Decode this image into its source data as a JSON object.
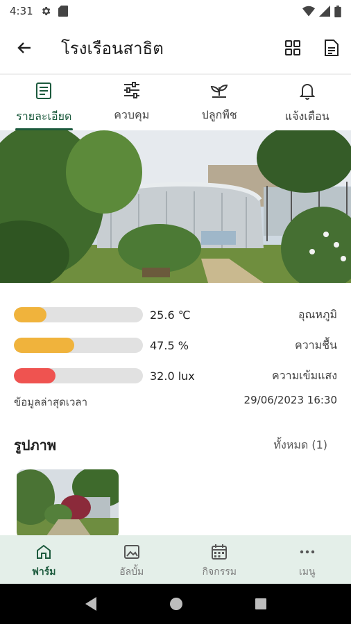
{
  "status_bar": {
    "time": "4:31",
    "icons": [
      "gear-icon",
      "sd-card-icon",
      "wifi-icon",
      "signal-icon",
      "battery-icon"
    ]
  },
  "app_bar": {
    "title": "โรงเรือนสาธิต",
    "actions": [
      "grid-view-icon",
      "document-icon"
    ]
  },
  "tabs": [
    {
      "label": "รายละเอียด",
      "icon": "details-icon",
      "active": true
    },
    {
      "label": "ควบคุม",
      "icon": "sliders-icon",
      "active": false
    },
    {
      "label": "ปลูกพืช",
      "icon": "plant-icon",
      "active": false
    },
    {
      "label": "แจ้งเตือน",
      "icon": "bell-icon",
      "active": false
    }
  ],
  "metrics": [
    {
      "value": "25.6 ℃",
      "label": "อุณหภูมิ",
      "level": 0.25,
      "color": "#f0b33c"
    },
    {
      "value": "47.5 %",
      "label": "ความชื้น",
      "level": 0.47,
      "color": "#f0b33c"
    },
    {
      "value": "32.0 lux",
      "label": "ความเข้มแสง",
      "level": 0.32,
      "color": "#ef5350"
    }
  ],
  "updated": {
    "label": "ข้อมูลล่าสุดเวลา",
    "value": "29/06/2023 16:30"
  },
  "photos": {
    "title": "รูปภาพ",
    "all_label": "ทั้งหมด (1)"
  },
  "bottom_nav": [
    {
      "label": "ฟาร์ม",
      "icon": "home-icon",
      "active": true
    },
    {
      "label": "อัลบั้ม",
      "icon": "image-icon",
      "active": false
    },
    {
      "label": "กิจกรรม",
      "icon": "calendar-icon",
      "active": false
    },
    {
      "label": "เมนู",
      "icon": "more-icon",
      "active": false
    }
  ],
  "colors": {
    "primary": "#1c5a3d",
    "nav_bg": "#e4efe9",
    "warning": "#f0b33c",
    "danger": "#ef5350"
  }
}
